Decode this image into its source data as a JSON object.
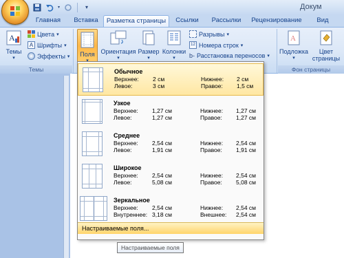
{
  "app": {
    "title": "Докум"
  },
  "qat": {
    "icons": [
      "save-icon",
      "undo-icon",
      "redo-icon",
      "customize-icon"
    ]
  },
  "tabs": [
    {
      "label": "Главная"
    },
    {
      "label": "Вставка"
    },
    {
      "label": "Разметка страницы"
    },
    {
      "label": "Ссылки"
    },
    {
      "label": "Рассылки"
    },
    {
      "label": "Рецензирование"
    },
    {
      "label": "Вид"
    }
  ],
  "ribbon": {
    "themes_group": {
      "label": "Темы",
      "themes_btn": "Темы",
      "colors": "Цвета",
      "fonts": "Шрифты",
      "effects": "Эффекты"
    },
    "page_setup": {
      "margins": "Поля",
      "orientation": "Ориентация",
      "size": "Размер",
      "columns": "Колонки",
      "breaks": "Разрывы",
      "line_numbers": "Номера строк",
      "hyphenation": "Расстановка переносов"
    },
    "page_bg": {
      "label": "Фон страницы",
      "watermark": "Подложка",
      "page_color_1": "Цвет",
      "page_color_2": "страницы"
    }
  },
  "margins_menu": {
    "items": [
      {
        "name": "Обычное",
        "top_label": "Верхнее:",
        "top": "2 см",
        "bottom_label": "Нижнее:",
        "bottom": "2 см",
        "left_label": "Левое:",
        "left": "3 см",
        "right_label": "Правое:",
        "right": "1,5 см"
      },
      {
        "name": "Узкое",
        "top_label": "Верхнее:",
        "top": "1,27 см",
        "bottom_label": "Нижнее:",
        "bottom": "1,27 см",
        "left_label": "Левое:",
        "left": "1,27 см",
        "right_label": "Правое:",
        "right": "1,27 см"
      },
      {
        "name": "Среднее",
        "top_label": "Верхнее:",
        "top": "2,54 см",
        "bottom_label": "Нижнее:",
        "bottom": "2,54 см",
        "left_label": "Левое:",
        "left": "1,91 см",
        "right_label": "Правое:",
        "right": "1,91 см"
      },
      {
        "name": "Широкое",
        "top_label": "Верхнее:",
        "top": "2,54 см",
        "bottom_label": "Нижнее:",
        "bottom": "2,54 см",
        "left_label": "Левое:",
        "left": "5,08 см",
        "right_label": "Правое:",
        "right": "5,08 см"
      },
      {
        "name": "Зеркальное",
        "top_label": "Верхнее:",
        "top": "2,54 см",
        "bottom_label": "Нижнее:",
        "bottom": "2,54 см",
        "left_label": "Внутреннее:",
        "left": "3,18 см",
        "right_label": "Внешнее:",
        "right": "2,54 см"
      }
    ],
    "custom": "Настраиваемые поля...",
    "tooltip": "Настраиваемые поля"
  }
}
